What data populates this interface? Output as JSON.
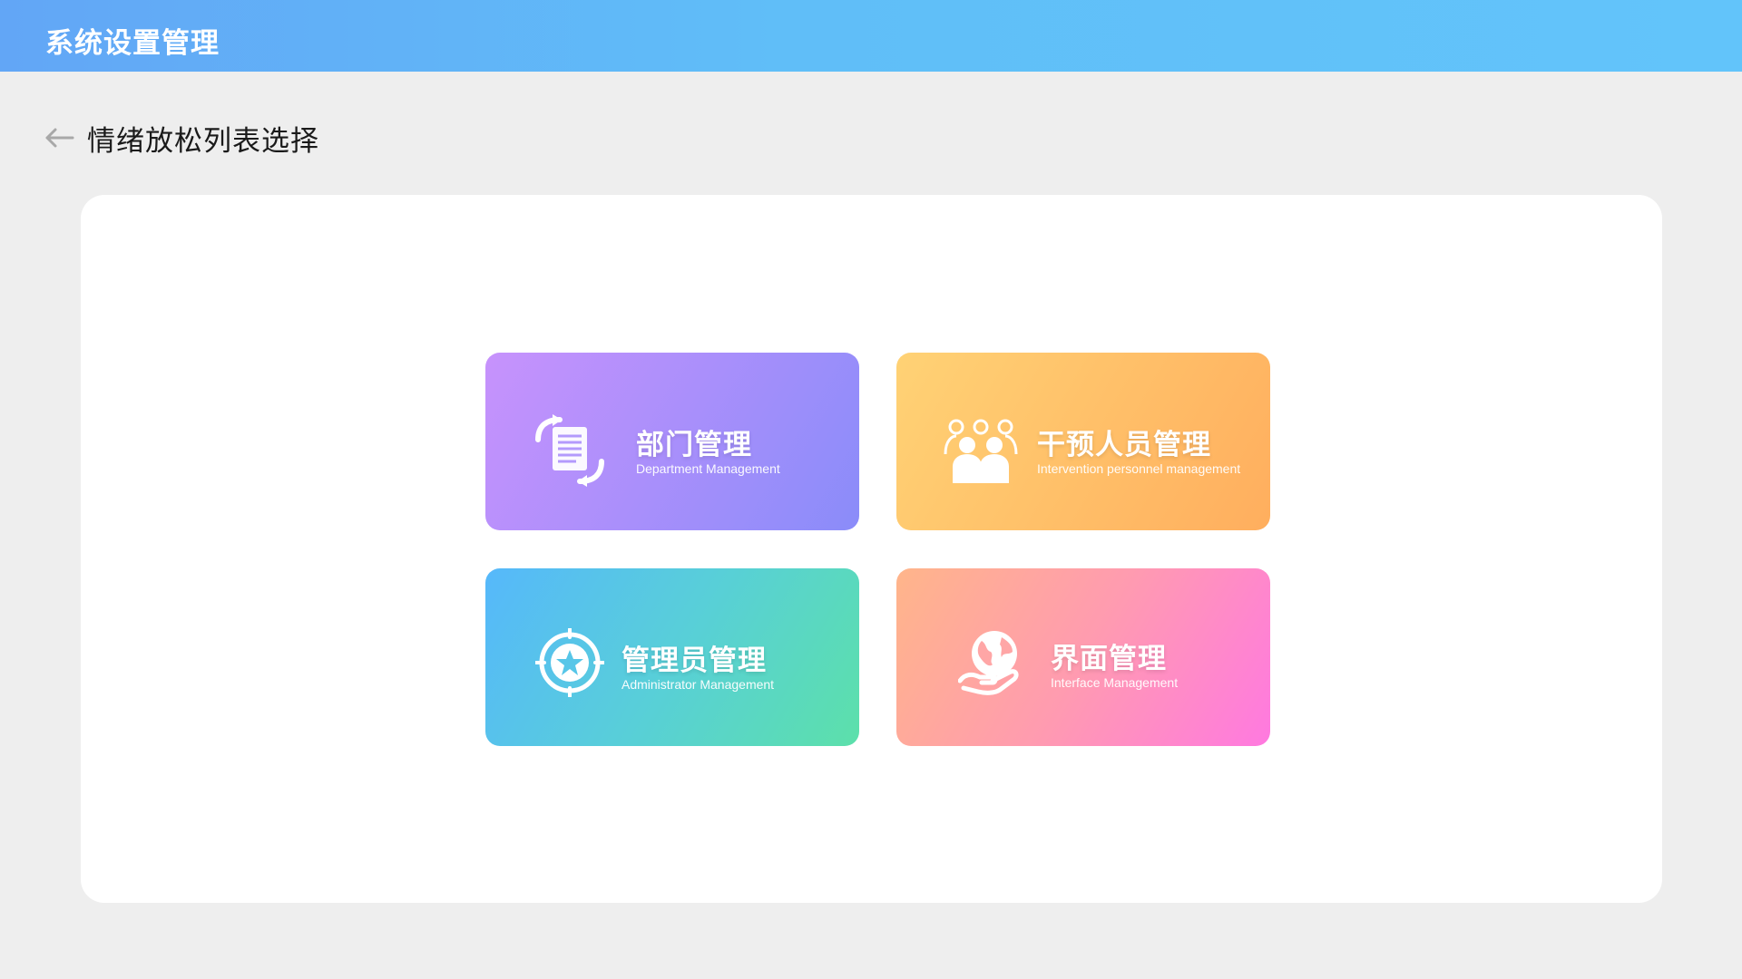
{
  "header": {
    "title": "系统设置管理"
  },
  "subheader": {
    "title": "情绪放松列表选择"
  },
  "cards": [
    {
      "title": "部门管理",
      "subtitle": "Department Management",
      "icon": "document-exchange-icon"
    },
    {
      "title": "干预人员管理",
      "subtitle": "Intervention personnel management",
      "icon": "group-people-icon"
    },
    {
      "title": "管理员管理",
      "subtitle": "Administrator Management",
      "icon": "star-target-icon"
    },
    {
      "title": "界面管理",
      "subtitle": "Interface Management",
      "icon": "globe-hand-icon"
    }
  ],
  "colors": {
    "topbar_start": "#62a6f6",
    "topbar_end": "#62c4fa",
    "card_department": [
      "#c792fc",
      "#8a8cf9"
    ],
    "card_intervention": [
      "#ffd275",
      "#ffae5e"
    ],
    "card_administrator": [
      "#56b8fb",
      "#5ce0aa"
    ],
    "card_interface": [
      "#ffb58a",
      "#ff79e0"
    ]
  }
}
